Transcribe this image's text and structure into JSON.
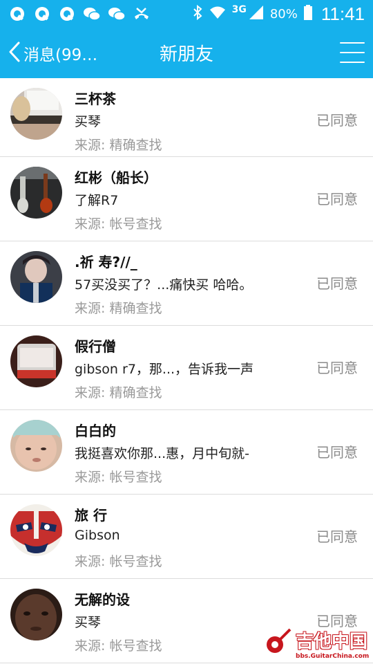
{
  "statusbar": {
    "network": "3G",
    "battery": "80%",
    "time": "11:41",
    "left_icons": [
      "qq-icon",
      "qq-icon",
      "qq-icon",
      "wechat-icon",
      "wechat-icon",
      "missed-call-icon"
    ],
    "right_icons": [
      "bluetooth-icon",
      "wifi-icon",
      "signal-icon",
      "battery-icon"
    ]
  },
  "nav": {
    "back_label": "消息(99…",
    "title": "新朋友"
  },
  "requests": [
    {
      "name": "三杯茶",
      "message": "买琴",
      "source": "来源: 精确查找",
      "status": "已同意"
    },
    {
      "name": "红彬（船长）",
      "message": "了解R7",
      "source": "来源: 帐号查找",
      "status": "已同意"
    },
    {
      "name": ".祈 寿?//_",
      "message": "57买没买了？...痛快买 哈哈。",
      "source": "来源: 精确查找",
      "status": "已同意"
    },
    {
      "name": "假行僧",
      "message": "gibson r7，那...，告诉我一声",
      "source": "来源: 精确查找",
      "status": "已同意"
    },
    {
      "name": "白白的",
      "message": "我挺喜欢你那...惠，月中旬就-",
      "source": "来源: 帐号查找",
      "status": "已同意"
    },
    {
      "name": "旅 行",
      "message": "Gibson",
      "source": "来源: 帐号查找",
      "status": "已同意"
    },
    {
      "name": "无解的设",
      "message": "买琴",
      "source": "来源: 帐号查找",
      "status": "已同意"
    }
  ],
  "watermark": {
    "main": "吉他中国",
    "sub": "bbs.GuitarChina.com"
  },
  "colors": {
    "header": "#16b1ec",
    "status_text": "#8a8a8a",
    "source_text": "#9a9a9a"
  }
}
